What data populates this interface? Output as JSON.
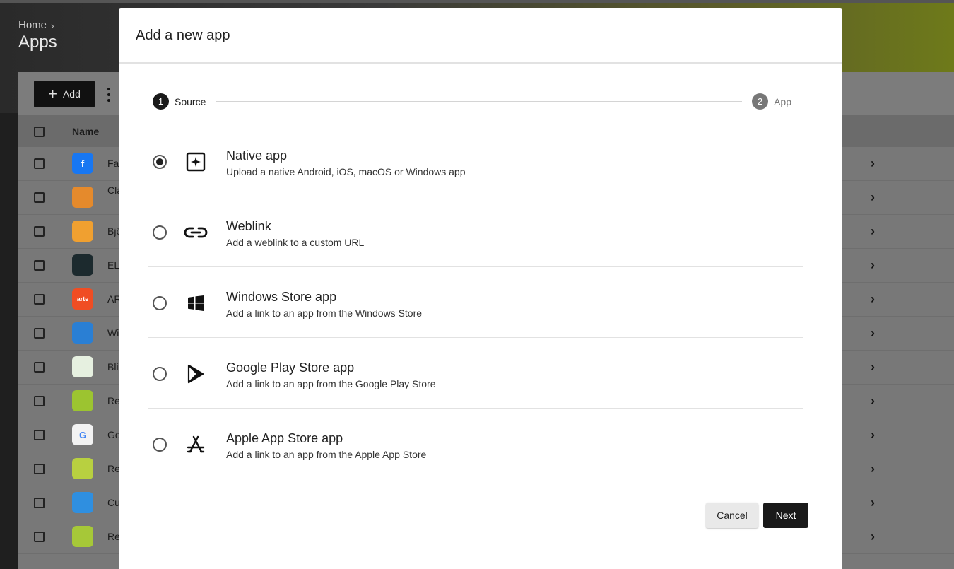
{
  "page": {
    "breadcrumb_home": "Home",
    "breadcrumb_sep": "›",
    "title": "Apps",
    "add_label": "Add",
    "table_header_name": "Name",
    "rows": [
      {
        "name": "Fac",
        "icon_color": "#1877f2",
        "icon_text": "f"
      },
      {
        "name": "Cla Ma",
        "icon_color": "#e58a2c",
        "icon_text": ""
      },
      {
        "name": "Bjö",
        "icon_color": "#f0a030",
        "icon_text": ""
      },
      {
        "name": "ELI",
        "icon_color": "#1c2a2e",
        "icon_text": ""
      },
      {
        "name": "AR",
        "icon_color": "#f04d23",
        "icon_text": "arte"
      },
      {
        "name": "Wi",
        "icon_color": "#2a7fd4",
        "icon_text": ""
      },
      {
        "name": "Bli",
        "icon_color": "#e6f0e0",
        "icon_text": ""
      },
      {
        "name": "Re",
        "icon_color": "#9cc430",
        "icon_text": ""
      },
      {
        "name": "Go",
        "icon_color": "#f2f2f2",
        "icon_text": "G"
      },
      {
        "name": "Re",
        "icon_color": "#b8d040",
        "icon_text": ""
      },
      {
        "name": "Cu",
        "icon_color": "#2f8fe0",
        "icon_text": ""
      },
      {
        "name": "Re",
        "icon_color": "#a6c838",
        "icon_text": ""
      }
    ]
  },
  "modal": {
    "title": "Add a new app",
    "steps": [
      {
        "number": "1",
        "label": "Source"
      },
      {
        "number": "2",
        "label": "App"
      }
    ],
    "options": [
      {
        "title": "Native app",
        "description": "Upload a native Android, iOS, macOS or Windows app",
        "icon": "native-app-icon",
        "selected": true
      },
      {
        "title": "Weblink",
        "description": "Add a weblink to a custom URL",
        "icon": "link-icon",
        "selected": false
      },
      {
        "title": "Windows Store app",
        "description": "Add a link to an app from the Windows Store",
        "icon": "windows-icon",
        "selected": false
      },
      {
        "title": "Google Play Store app",
        "description": "Add a link to an app from the Google Play Store",
        "icon": "google-play-icon",
        "selected": false
      },
      {
        "title": "Apple App Store app",
        "description": "Add a link to an app from the Apple App Store",
        "icon": "app-store-icon",
        "selected": false
      }
    ],
    "cancel_label": "Cancel",
    "next_label": "Next"
  }
}
